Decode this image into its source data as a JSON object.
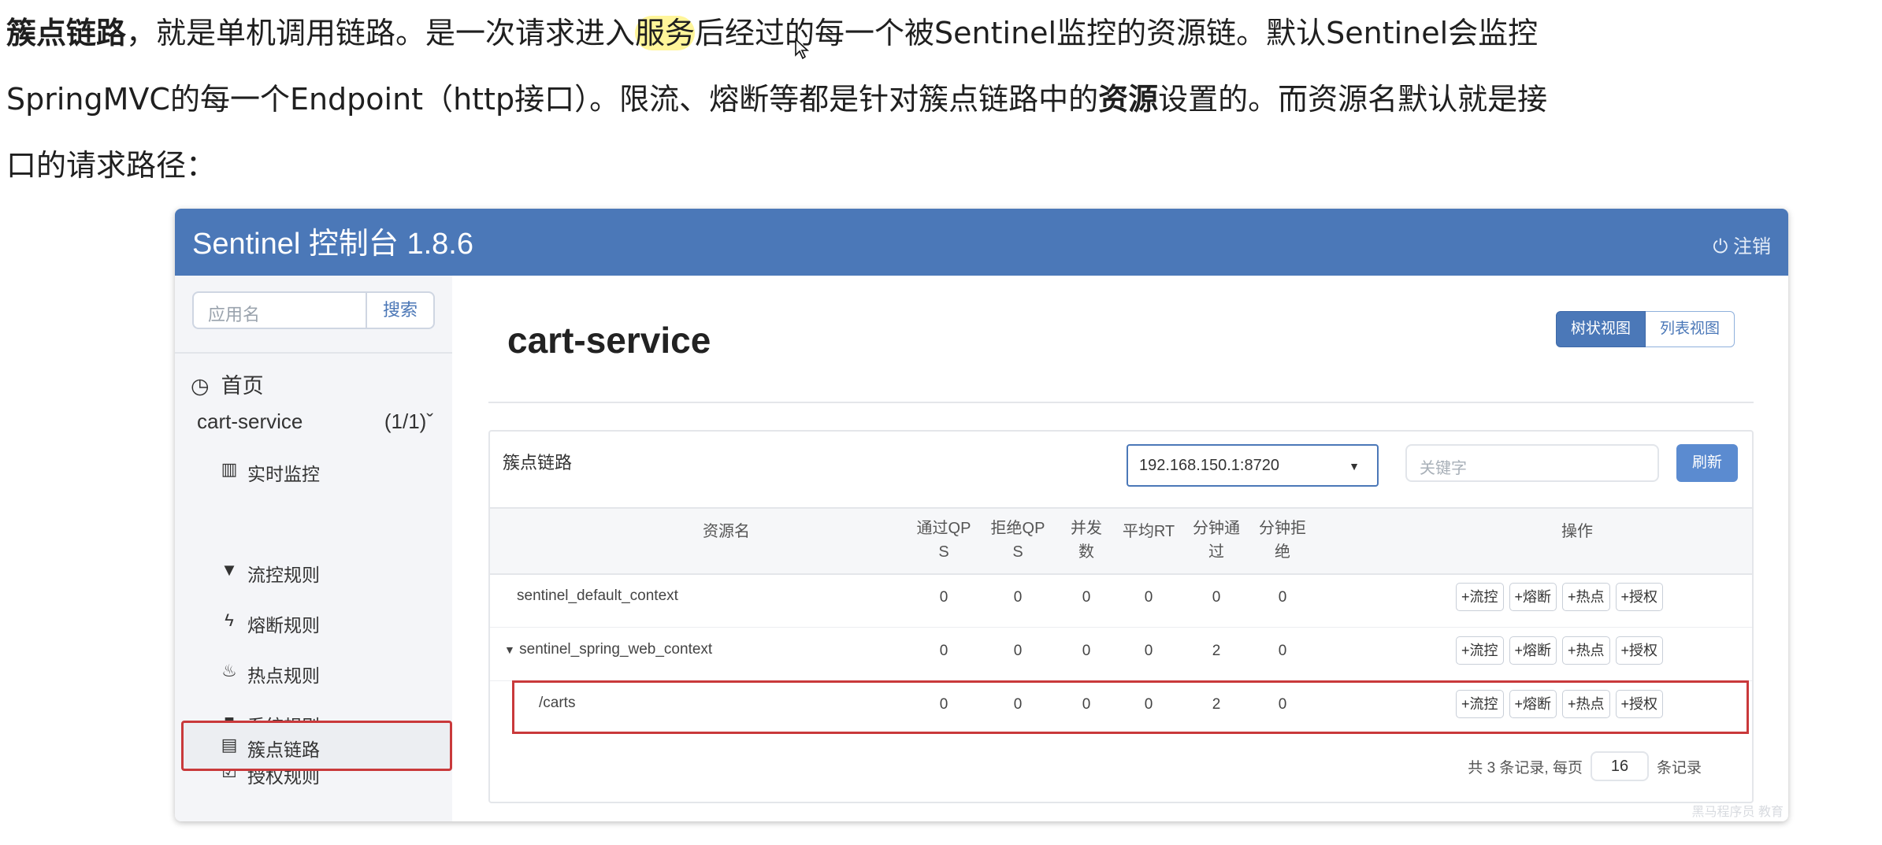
{
  "intro": {
    "bold_term": "簇点链路",
    "part1": "，就是单机调用链路。是一次请求进入",
    "highlight": "服务",
    "part2": "后经过的每一个被Sentinel监控的资源链。默认Sentinel会监控",
    "part3": "SpringMVC的每一个Endpoint（http接口）。限流、熔断等都是针对簇点链路中的",
    "bold_resource": "资源",
    "part4": "设置的。而资源名默认就是接",
    "part5": "口的请求路径："
  },
  "console": {
    "title": "Sentinel 控制台 1.8.6",
    "logout_label": "注销",
    "sidebar": {
      "search_placeholder": "应用名",
      "search_button": "搜索",
      "home_label": "首页",
      "app_name": "cart-service",
      "app_count": "(1/1)",
      "items": [
        {
          "label": "实时监控",
          "icon": "bar-chart-icon"
        },
        {
          "label": "簇点链路",
          "icon": "list-icon"
        },
        {
          "label": "流控规则",
          "icon": "filter-icon"
        },
        {
          "label": "熔断规则",
          "icon": "bolt-icon"
        },
        {
          "label": "热点规则",
          "icon": "fire-icon"
        },
        {
          "label": "系统规则",
          "icon": "lock-icon"
        },
        {
          "label": "授权规则",
          "icon": "check-icon"
        }
      ]
    },
    "main": {
      "app_title": "cart-service",
      "view_tree": "树状视图",
      "view_list": "列表视图",
      "card_title": "簇点链路",
      "machine": "192.168.150.1:8720",
      "keyword_placeholder": "关键字",
      "refresh": "刷新",
      "columns": [
        "资源名",
        "通过QP\nS",
        "拒绝QP\nS",
        "并发\n数",
        "平均RT",
        "分钟通\n过",
        "分钟拒\n绝",
        "操作"
      ],
      "rows": [
        {
          "name": "sentinel_default_context",
          "pass_qps": "0",
          "block_qps": "0",
          "threads": "0",
          "avg_rt": "0",
          "minute_pass": "0",
          "minute_block": "0"
        },
        {
          "name": "sentinel_spring_web_context",
          "pass_qps": "0",
          "block_qps": "0",
          "threads": "0",
          "avg_rt": "0",
          "minute_pass": "2",
          "minute_block": "0"
        },
        {
          "name": "/carts",
          "pass_qps": "0",
          "block_qps": "0",
          "threads": "0",
          "avg_rt": "0",
          "minute_pass": "2",
          "minute_block": "0"
        }
      ],
      "ops": [
        "+流控",
        "+熔断",
        "+热点",
        "+授权"
      ],
      "footer_prefix": "共 3 条记录, 每页",
      "page_size": "16",
      "footer_suffix": "条记录"
    },
    "watermark": "黑马程序员 教育"
  },
  "colors": {
    "header": "#4b78b8",
    "highlight_box": "#c9393b",
    "text_highlight": "#fff59a"
  }
}
